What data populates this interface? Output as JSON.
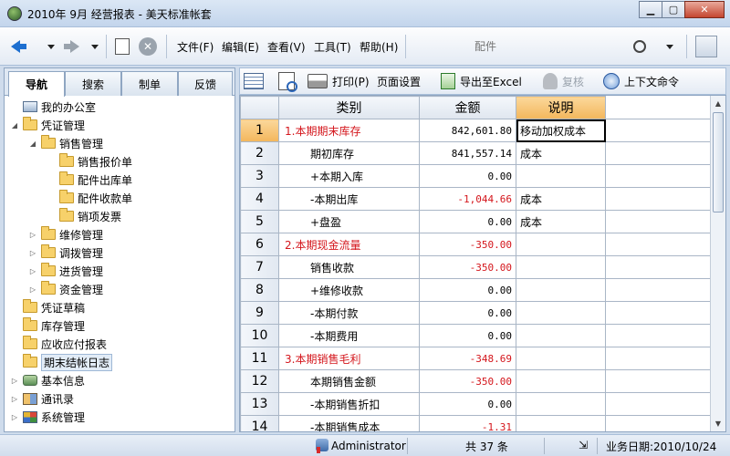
{
  "window": {
    "title": "2010年 9月 经营报表 - 美天标准帐套",
    "minimize": "▁",
    "maximize": "▢",
    "close": "✕"
  },
  "toolbar": {
    "menus": [
      "文件(F)",
      "编辑(E)",
      "查看(V)",
      "工具(T)",
      "帮助(H)"
    ],
    "search_placeholder": "配件"
  },
  "left_tabs": [
    {
      "label": "导航",
      "active": true
    },
    {
      "label": "搜索",
      "active": false
    },
    {
      "label": "制单",
      "active": false
    },
    {
      "label": "反馈",
      "active": false
    }
  ],
  "tree": [
    {
      "label": "我的办公室",
      "level": 0,
      "icon": "computer-icon",
      "expander": ""
    },
    {
      "label": "凭证管理",
      "level": 0,
      "icon": "folder-icon",
      "expander": "◢"
    },
    {
      "label": "销售管理",
      "level": 1,
      "icon": "folder-icon",
      "expander": "◢"
    },
    {
      "label": "销售报价单",
      "level": 2,
      "icon": "folder-icon",
      "expander": ""
    },
    {
      "label": "配件出库单",
      "level": 2,
      "icon": "folder-icon",
      "expander": ""
    },
    {
      "label": "配件收款单",
      "level": 2,
      "icon": "folder-icon",
      "expander": ""
    },
    {
      "label": "销项发票",
      "level": 2,
      "icon": "folder-icon",
      "expander": ""
    },
    {
      "label": "维修管理",
      "level": 1,
      "icon": "folder-icon",
      "expander": "▷"
    },
    {
      "label": "调拨管理",
      "level": 1,
      "icon": "folder-icon",
      "expander": "▷"
    },
    {
      "label": "进货管理",
      "level": 1,
      "icon": "folder-icon",
      "expander": "▷"
    },
    {
      "label": "资金管理",
      "level": 1,
      "icon": "folder-icon",
      "expander": "▷"
    },
    {
      "label": "凭证草稿",
      "level": 0,
      "icon": "folder-icon",
      "expander": ""
    },
    {
      "label": "库存管理",
      "level": 0,
      "icon": "folder-icon",
      "expander": ""
    },
    {
      "label": "应收应付报表",
      "level": 0,
      "icon": "folder-icon",
      "expander": ""
    },
    {
      "label": "期末结帐日志",
      "level": 0,
      "icon": "folder-icon",
      "expander": "",
      "selected": true
    },
    {
      "label": "基本信息",
      "level": 0,
      "icon": "info-icon",
      "expander": "▷"
    },
    {
      "label": "通讯录",
      "level": 0,
      "icon": "contacts-icon",
      "expander": "▷"
    },
    {
      "label": "系统管理",
      "level": 0,
      "icon": "system-icon",
      "expander": "▷"
    }
  ],
  "report_toolbar": {
    "print": "打印(P)",
    "page_setup": "页面设置",
    "export_excel": "导出至Excel",
    "review": "复核",
    "context_cmd": "上下文命令"
  },
  "grid": {
    "headers": [
      "类别",
      "金额",
      "说明"
    ],
    "rows": [
      {
        "n": "1",
        "category": "1.本期期末库存",
        "amount": "842,601.80",
        "note": "移动加权成本",
        "red_cat": true,
        "red_amt": false
      },
      {
        "n": "2",
        "category": "期初库存",
        "amount": "841,557.14",
        "note": "成本",
        "red_cat": false,
        "red_amt": false
      },
      {
        "n": "3",
        "category": "+本期入库",
        "amount": "0.00",
        "note": "",
        "red_cat": false,
        "red_amt": false
      },
      {
        "n": "4",
        "category": "-本期出库",
        "amount": "-1,044.66",
        "note": "成本",
        "red_cat": false,
        "red_amt": true
      },
      {
        "n": "5",
        "category": "+盘盈",
        "amount": "0.00",
        "note": "成本",
        "red_cat": false,
        "red_amt": false
      },
      {
        "n": "6",
        "category": "2.本期现金流量",
        "amount": "-350.00",
        "note": "",
        "red_cat": true,
        "red_amt": true
      },
      {
        "n": "7",
        "category": "销售收款",
        "amount": "-350.00",
        "note": "",
        "red_cat": false,
        "red_amt": true
      },
      {
        "n": "8",
        "category": "+维修收款",
        "amount": "0.00",
        "note": "",
        "red_cat": false,
        "red_amt": false
      },
      {
        "n": "9",
        "category": "-本期付款",
        "amount": "0.00",
        "note": "",
        "red_cat": false,
        "red_amt": false
      },
      {
        "n": "10",
        "category": "-本期费用",
        "amount": "0.00",
        "note": "",
        "red_cat": false,
        "red_amt": false
      },
      {
        "n": "11",
        "category": "3.本期销售毛利",
        "amount": "-348.69",
        "note": "",
        "red_cat": true,
        "red_amt": true
      },
      {
        "n": "12",
        "category": "本期销售金额",
        "amount": "-350.00",
        "note": "",
        "red_cat": false,
        "red_amt": true
      },
      {
        "n": "13",
        "category": "-本期销售折扣",
        "amount": "0.00",
        "note": "",
        "red_cat": false,
        "red_amt": false
      },
      {
        "n": "14",
        "category": "-本期销售成本",
        "amount": "-1.31",
        "note": "",
        "red_cat": false,
        "red_amt": true
      }
    ]
  },
  "status": {
    "user": "Administrator",
    "count": "共 37 条",
    "date": "业务日期:2010/10/24"
  },
  "colors": {
    "red_text": "#d4161c",
    "highlight_header": "#f3b65c"
  }
}
